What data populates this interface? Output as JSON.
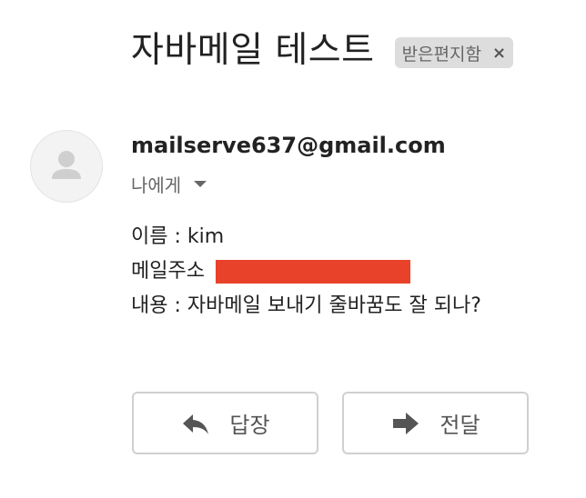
{
  "email": {
    "subject": "자바메일 테스트",
    "label_chip": "받은편지함",
    "label_close": "×",
    "sender": "mailserve637@gmail.com",
    "recipient": "나에게",
    "body": {
      "name_line": "이름 : kim",
      "email_label": "메일주소",
      "content_line": "내용 : 자바메일 보내기 줄바꿈도 잘 되나?"
    }
  },
  "actions": {
    "reply_label": "답장",
    "forward_label": "전달"
  },
  "icons": {
    "avatar": "person-icon",
    "recipient_dropdown": "caret-down-icon",
    "reply": "reply-arrow-icon",
    "forward": "forward-arrow-icon"
  },
  "colors": {
    "redaction": "#e8432a",
    "chip_background": "#dddddd"
  }
}
